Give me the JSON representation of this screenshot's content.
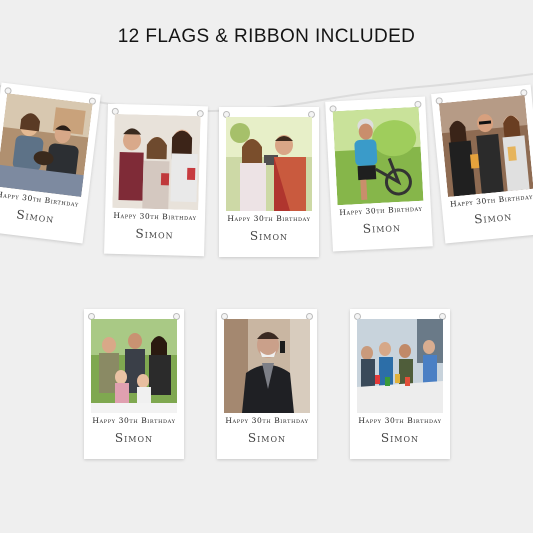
{
  "headline": "12 FLAGS & RIBBON INCLUDED",
  "flags": [
    {
      "line1": "Happy 30th Birthday",
      "line2": "Simon",
      "photo": "couple-with-dog"
    },
    {
      "line1": "Happy 30th Birthday",
      "line2": "Simon",
      "photo": "family-with-drink"
    },
    {
      "line1": "Happy 30th Birthday",
      "line2": "Simon",
      "photo": "couple-selfie"
    },
    {
      "line1": "Happy 30th Birthday",
      "line2": "Simon",
      "photo": "cyclist"
    },
    {
      "line1": "Happy 30th Birthday",
      "line2": "Simon",
      "photo": "friends-toasting"
    },
    {
      "line1": "Happy 30th Birthday",
      "line2": "Simon",
      "photo": "family-group-garden"
    },
    {
      "line1": "Happy 30th Birthday",
      "line2": "Simon",
      "photo": "man-on-phone"
    },
    {
      "line1": "Happy 30th Birthday",
      "line2": "Simon",
      "photo": "party-celebration"
    }
  ],
  "colors": {
    "background": "#efefef",
    "card": "#ffffff",
    "ribbon": "#dcdcdc"
  }
}
